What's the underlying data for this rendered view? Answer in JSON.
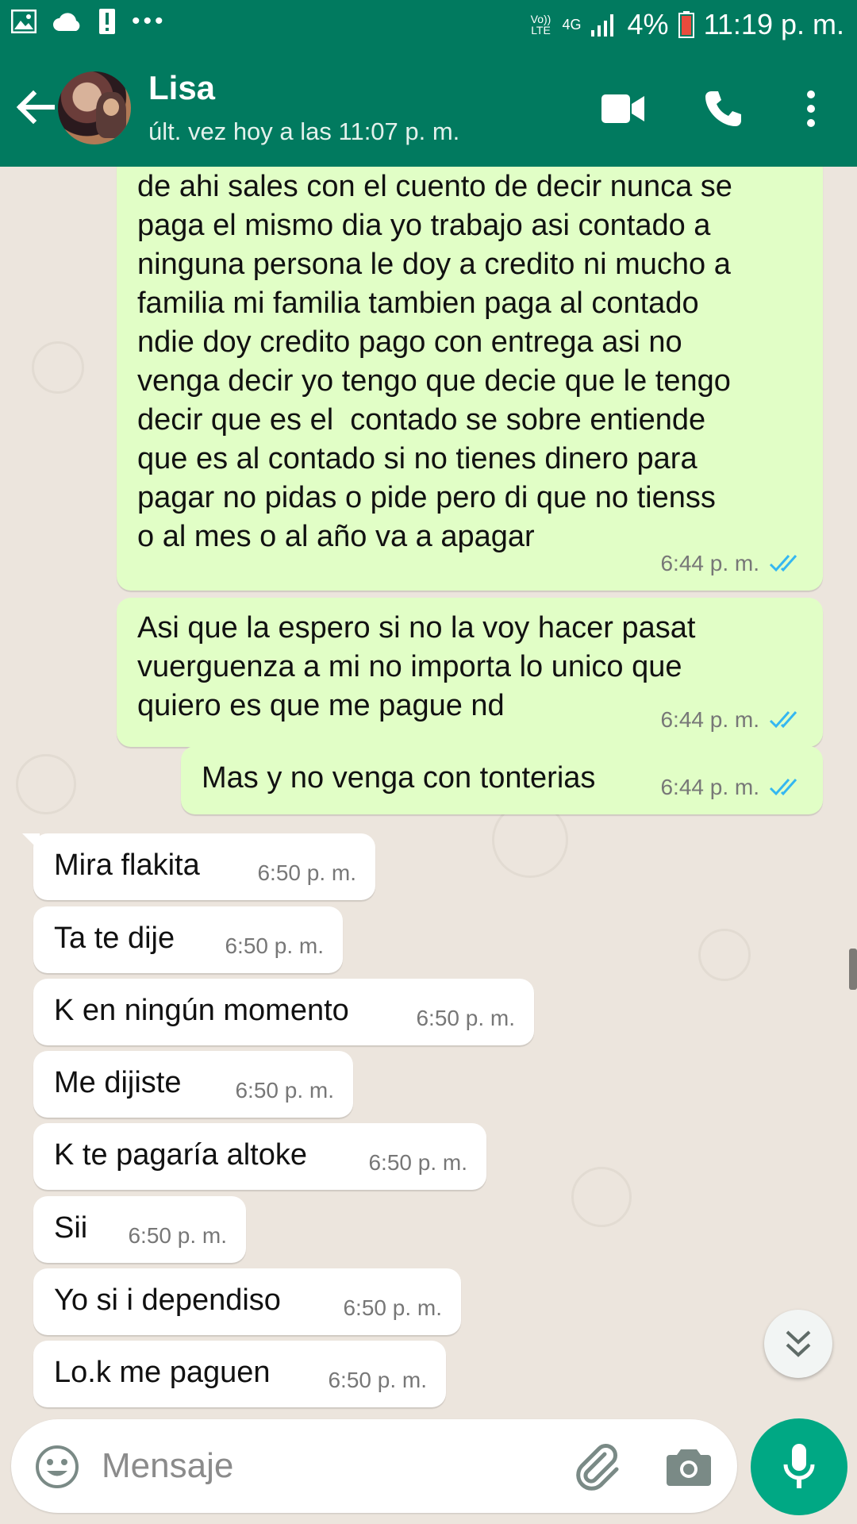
{
  "status_bar": {
    "network": "Vo)) LTE",
    "signal_type": "4G",
    "battery": "4%",
    "time": "11:19 p. m."
  },
  "header": {
    "contact_name": "Lisa",
    "last_seen": "últ. vez hoy a las 11:07 p. m."
  },
  "messages": [
    {
      "direction": "out",
      "text": "me dijo en mi casa te doy vienes a cobrar\nde ahi sales con el cuento de decir nunca se\npaga el mismo dia yo trabajo asi contado a\nninguna persona le doy a credito ni mucho a\nfamilia mi familia tambien paga al contado\nndie doy credito pago con entrega asi no\nvenga decir yo tengo que decie que le tengo\ndecir que es el  contado se sobre entiende\nque es al contado si no tienes dinero para\npagar no pidas o pide pero di que no tienss\no al mes o al año va a apagar",
      "time": "6:44 p. m."
    },
    {
      "direction": "out",
      "text": "Asi que la espero si no la voy hacer pasat\nvuerguenza a mi no importa lo unico que\nquiero es que me pague nd",
      "time": "6:44 p. m."
    },
    {
      "direction": "out",
      "text": "Mas y no venga con tonterias",
      "time": "6:44 p. m."
    },
    {
      "direction": "in",
      "text": "Mira flakita",
      "time": "6:50 p. m."
    },
    {
      "direction": "in",
      "text": "Ta te dije",
      "time": "6:50 p. m."
    },
    {
      "direction": "in",
      "text": "K en ningún momento",
      "time": "6:50 p. m."
    },
    {
      "direction": "in",
      "text": "Me dijiste",
      "time": "6:50 p. m."
    },
    {
      "direction": "in",
      "text": "K te pagaría altoke",
      "time": "6:50 p. m."
    },
    {
      "direction": "in",
      "text": "Sii",
      "time": "6:50 p. m."
    },
    {
      "direction": "in",
      "text": "Yo si i dependiso",
      "time": "6:50 p. m."
    },
    {
      "direction": "in",
      "text": "Lo.k me paguen",
      "time": "6:50 p. m."
    }
  ],
  "composer": {
    "placeholder": "Mensaje"
  },
  "colors": {
    "header": "#017a5f",
    "outgoing_bubble": "#e1fec6",
    "incoming_bubble": "#ffffff",
    "read_ticks": "#34b7f1",
    "mic_button": "#00a884"
  }
}
